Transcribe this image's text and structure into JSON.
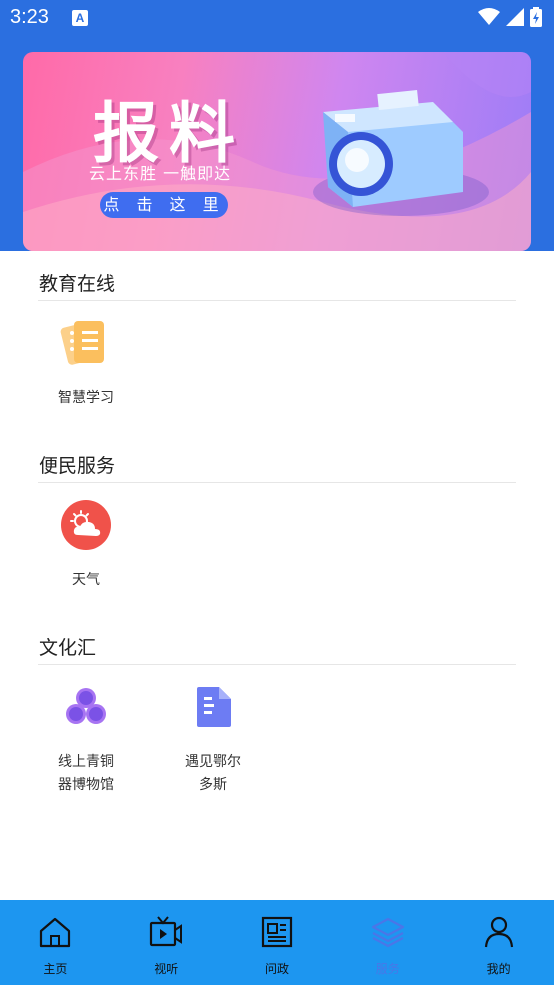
{
  "status_bar": {
    "time": "3:23",
    "notification_letter": "A"
  },
  "banner": {
    "title": "报料",
    "subtitle": "云上东胜  一触即达",
    "button_label": "点 击 这 里"
  },
  "sections": [
    {
      "title": "教育在线",
      "items": [
        {
          "label": "智慧学习",
          "icon": "notebook-icon"
        }
      ]
    },
    {
      "title": "便民服务",
      "items": [
        {
          "label": "天气",
          "icon": "weather-icon"
        }
      ]
    },
    {
      "title": "文化汇",
      "items": [
        {
          "label": "线上青铜\n器博物馆",
          "icon": "circles-icon"
        },
        {
          "label": "遇见鄂尔\n多斯",
          "icon": "document-icon"
        }
      ]
    }
  ],
  "bottom_nav": [
    {
      "label": "主页",
      "icon": "home-icon"
    },
    {
      "label": "视听",
      "icon": "tv-icon"
    },
    {
      "label": "问政",
      "icon": "newspaper-icon"
    },
    {
      "label": "服务",
      "icon": "layers-icon",
      "active": true
    },
    {
      "label": "我的",
      "icon": "user-icon"
    }
  ],
  "colors": {
    "header": "#2b6fe0",
    "nav_bg": "#1d96f0",
    "nav_active": "#4a76e8",
    "weather": "#f0524a",
    "notebook": "#fbbf5e"
  }
}
